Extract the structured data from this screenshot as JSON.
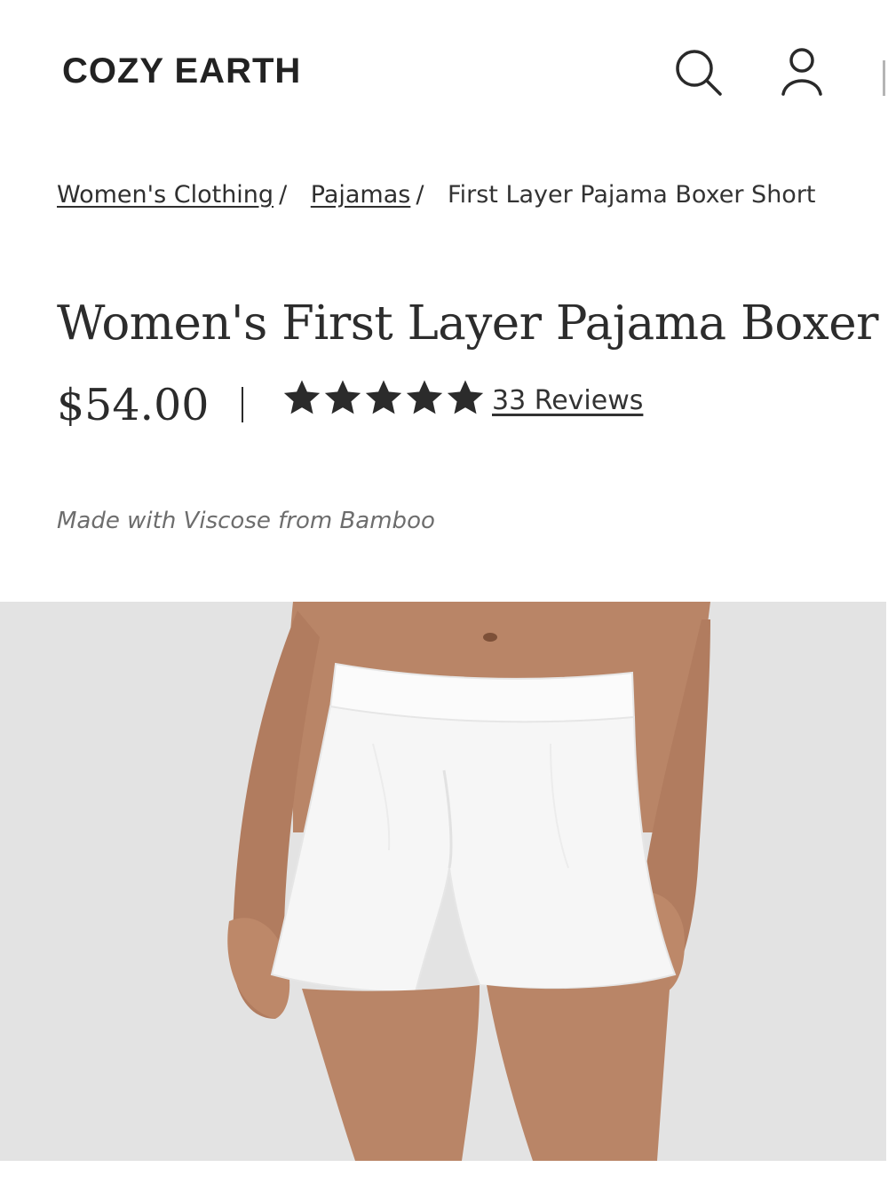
{
  "header": {
    "logo_text": "COZY EARTH",
    "icons": [
      "search-icon",
      "account-icon"
    ]
  },
  "breadcrumb": {
    "items": [
      {
        "label": "Women's Clothing",
        "separator": "/"
      },
      {
        "label": "Pajamas",
        "separator": "/"
      }
    ],
    "current": "First Layer Pajama Boxer Short"
  },
  "product": {
    "title": "Women's First Layer Pajama Boxer Short",
    "price": "$54.00",
    "rating": 5,
    "rating_max": 5,
    "reviews_label": "33 Reviews",
    "subtitle": "Made with Viscose from Bamboo"
  },
  "colors": {
    "text": "#2b2b2b",
    "muted": "#6d6d6d",
    "image_bg": "#e3e3e3"
  }
}
